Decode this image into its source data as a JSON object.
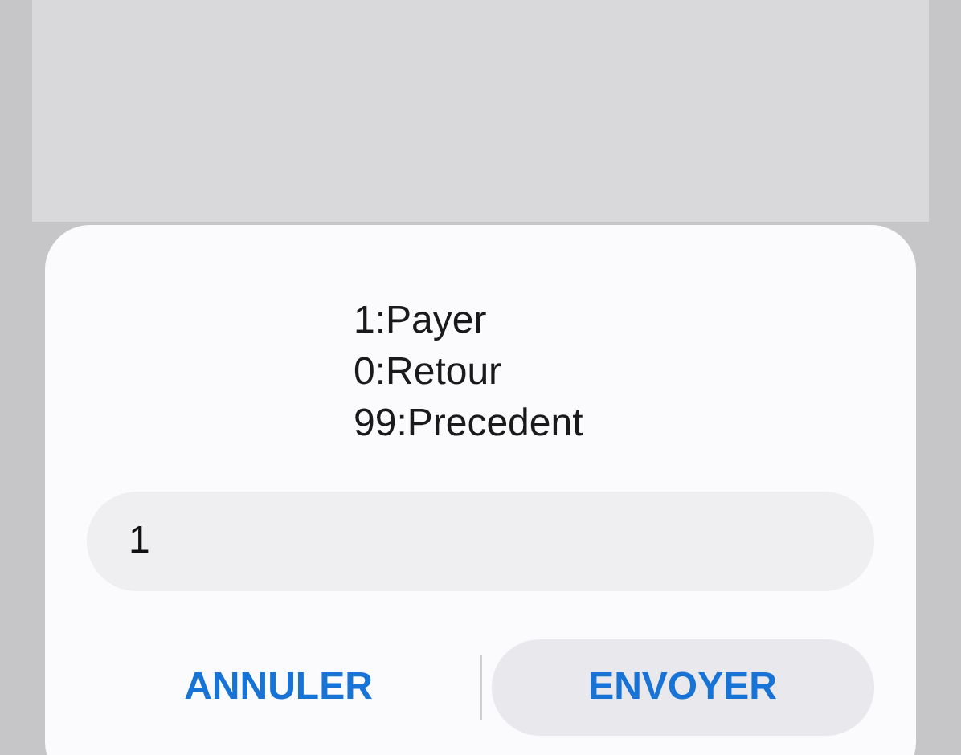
{
  "dialog": {
    "message": [
      "1:Payer",
      "0:Retour",
      "99:Precedent"
    ],
    "input": {
      "value": "1"
    },
    "buttons": [
      {
        "label": "ANNULER",
        "pressed": false
      },
      {
        "label": "ENVOYER",
        "pressed": true
      }
    ]
  }
}
